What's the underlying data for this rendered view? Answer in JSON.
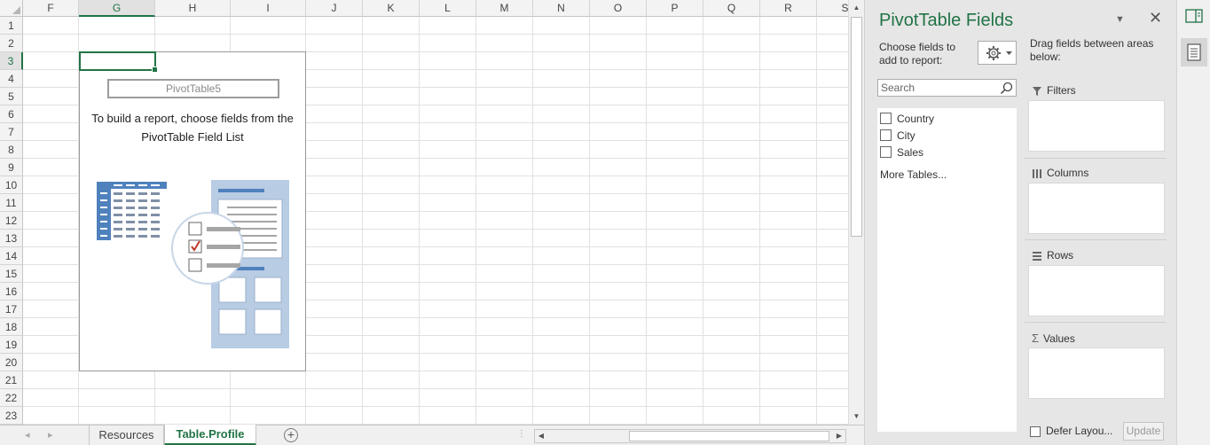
{
  "grid": {
    "columns": [
      "F",
      "G",
      "H",
      "I",
      "J",
      "K",
      "L",
      "M",
      "N",
      "O",
      "P",
      "Q",
      "R",
      "S"
    ],
    "selected_column": "G",
    "rows": [
      "1",
      "2",
      "3",
      "4",
      "5",
      "6",
      "7",
      "8",
      "9",
      "10",
      "11",
      "12",
      "13",
      "14",
      "15",
      "16",
      "17",
      "18",
      "19",
      "20",
      "21",
      "22",
      "23"
    ],
    "selected_row": "3"
  },
  "pivot_placeholder": {
    "name": "PivotTable5",
    "hint": "To build a report, choose fields from the PivotTable Field List"
  },
  "sheet_tabs": [
    {
      "label": "Resources",
      "active": false
    },
    {
      "label": "Table.Profile",
      "active": true
    }
  ],
  "pane": {
    "title": "PivotTable Fields",
    "choose_label": "Choose fields to add to report:",
    "search_placeholder": "Search",
    "fields": [
      {
        "label": "Country",
        "checked": false
      },
      {
        "label": "City",
        "checked": false
      },
      {
        "label": "Sales",
        "checked": false
      }
    ],
    "more_tables": "More Tables...",
    "drag_label": "Drag fields between areas below:",
    "areas": {
      "filters": "Filters",
      "columns": "Columns",
      "rows": "Rows",
      "values": "Values"
    },
    "defer_label": "Defer Layou...",
    "update_label": "Update"
  },
  "colors": {
    "accent": "#217346",
    "pivot_blue": "#4f81bd",
    "pivot_light": "#b8cce4",
    "check_red": "#c0392b"
  },
  "icons": [
    "gear-icon",
    "search-icon",
    "filter-icon",
    "columns-icon",
    "rows-icon",
    "sigma-icon",
    "close-icon",
    "pane-menu-icon",
    "pane-toggle-icon",
    "field-list-icon"
  ]
}
